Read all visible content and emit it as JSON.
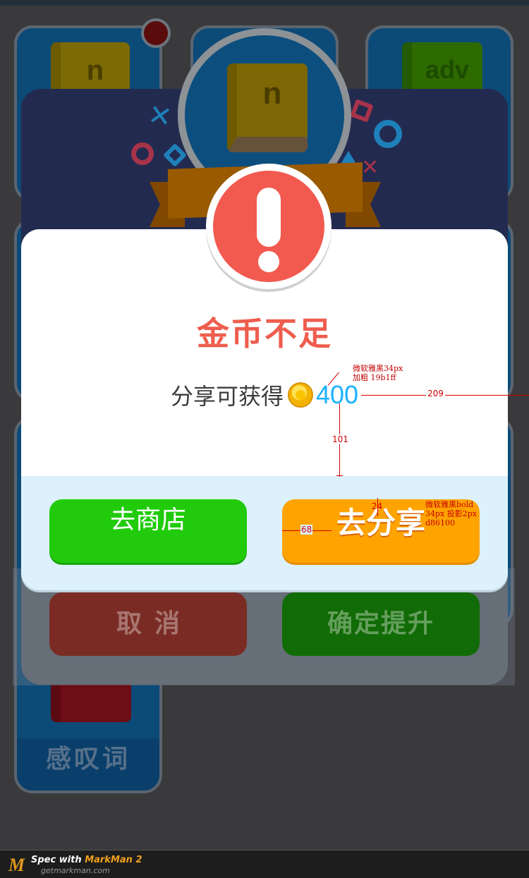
{
  "background": {
    "card_labels": [
      "n",
      "adv"
    ],
    "card_word": "感叹词",
    "medal_label": "n"
  },
  "level_dialog": {
    "cancel_label": "取消",
    "confirm_label": "确定提升"
  },
  "dialog": {
    "title": "金币不足",
    "reward_label": "分享可获得",
    "reward_amount": "400",
    "shop_button": "去商店",
    "share_button": "去分享"
  },
  "annotations": {
    "font_note_1": "微软雅黑34px",
    "font_note_2": "加粗 19b1ff",
    "btn_note_1": "微软雅黑bold",
    "btn_note_2": "34px 投影2px",
    "btn_note_3": "d86100",
    "dist_right": "209",
    "dist_down": "101",
    "dist_top": "24",
    "dist_left": "68"
  },
  "footer": {
    "logo": "M",
    "spec_with": "Spec with",
    "brand": "MarkMan 2",
    "url": "getmarkman.com"
  },
  "colors": {
    "title": "#ee5d4e",
    "amount": "#19b1ff",
    "shop": "#21cb0c",
    "share": "#ffa300",
    "share_shadow": "#d86100"
  }
}
